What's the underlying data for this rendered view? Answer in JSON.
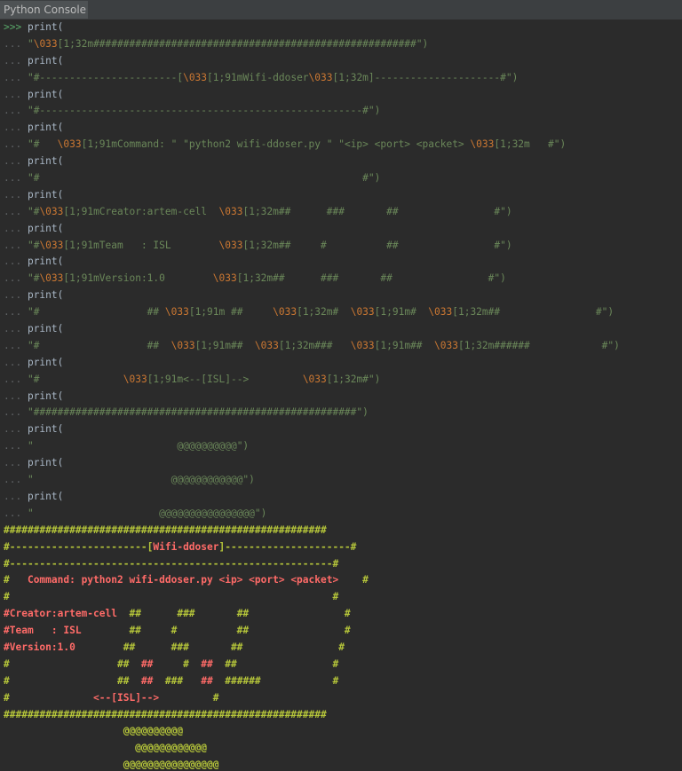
{
  "window": {
    "tab_label": "Python Console"
  },
  "console": {
    "prompt": ">>>",
    "continuation": "...",
    "print_call": "print(",
    "inputs": [
      [
        [
          "s",
          "\""
        ],
        [
          "esc",
          "\\033"
        ],
        [
          "s",
          "[1;32m######################################################\")"
        ]
      ],
      [
        [
          "s",
          "\"#-----------------------["
        ],
        [
          "esc",
          "\\033"
        ],
        [
          "s",
          "[1;91mWifi-ddoser"
        ],
        [
          "esc",
          "\\033"
        ],
        [
          "s",
          "[1;32m]---------------------#\")"
        ]
      ],
      [
        [
          "s",
          "\"#------------------------------------------------------#\")"
        ]
      ],
      [
        [
          "s",
          "\"#   "
        ],
        [
          "esc",
          "\\033"
        ],
        [
          "s",
          "[1;91mCommand: \" \"python2 wifi-ddoser.py \" \"<ip> <port> <packet> "
        ],
        [
          "esc",
          "\\033"
        ],
        [
          "s",
          "[1;32m   #\")"
        ]
      ],
      [
        [
          "s",
          "\"#                                                      #\")"
        ]
      ],
      [
        [
          "s",
          "\"#"
        ],
        [
          "esc",
          "\\033"
        ],
        [
          "s",
          "[1;91mCreator:artem-cell  "
        ],
        [
          "esc",
          "\\033"
        ],
        [
          "s",
          "[1;32m##      ###       ##                #\")"
        ]
      ],
      [
        [
          "s",
          "\"#"
        ],
        [
          "esc",
          "\\033"
        ],
        [
          "s",
          "[1;91mTeam   : ISL        "
        ],
        [
          "esc",
          "\\033"
        ],
        [
          "s",
          "[1;32m##     #          ##                #\")"
        ]
      ],
      [
        [
          "s",
          "\"#"
        ],
        [
          "esc",
          "\\033"
        ],
        [
          "s",
          "[1;91mVersion:1.0        "
        ],
        [
          "esc",
          "\\033"
        ],
        [
          "s",
          "[1;32m##      ###       ##                #\")"
        ]
      ],
      [
        [
          "s",
          "\"#                  ## "
        ],
        [
          "esc",
          "\\033"
        ],
        [
          "s",
          "[1;91m ##     "
        ],
        [
          "esc",
          "\\033"
        ],
        [
          "s",
          "[1;32m#  "
        ],
        [
          "esc",
          "\\033"
        ],
        [
          "s",
          "[1;91m#  "
        ],
        [
          "esc",
          "\\033"
        ],
        [
          "s",
          "[1;32m##                #\")"
        ]
      ],
      [
        [
          "s",
          "\"#                  ##  "
        ],
        [
          "esc",
          "\\033"
        ],
        [
          "s",
          "[1;91m##  "
        ],
        [
          "esc",
          "\\033"
        ],
        [
          "s",
          "[1;32m###   "
        ],
        [
          "esc",
          "\\033"
        ],
        [
          "s",
          "[1;91m##  "
        ],
        [
          "esc",
          "\\033"
        ],
        [
          "s",
          "[1;32m######            #\")"
        ]
      ],
      [
        [
          "s",
          "\"#              "
        ],
        [
          "esc",
          "\\033"
        ],
        [
          "s",
          "[1;91m<--[ISL]-->         "
        ],
        [
          "esc",
          "\\033"
        ],
        [
          "s",
          "[1;32m#\")"
        ]
      ],
      [
        [
          "s",
          "\"######################################################\")"
        ]
      ],
      [
        [
          "s",
          "\"                        @@@@@@@@@@\")"
        ]
      ],
      [
        [
          "s",
          "\"                       @@@@@@@@@@@@\")"
        ]
      ],
      [
        [
          "s",
          "\"                     @@@@@@@@@@@@@@@@\")"
        ]
      ]
    ],
    "output": [
      [
        [
          "g",
          "######################################################"
        ]
      ],
      [
        [
          "g",
          "#-----------------------["
        ],
        [
          "r",
          "Wifi-ddoser"
        ],
        [
          "g",
          "]---------------------#"
        ]
      ],
      [
        [
          "g",
          "#------------------------------------------------------#"
        ]
      ],
      [
        [
          "g",
          "#   "
        ],
        [
          "r",
          "Command: python2 wifi-ddoser.py <ip> <port> <packet>"
        ],
        [
          "g",
          "    #"
        ]
      ],
      [
        [
          "g",
          "#                                                      #"
        ]
      ],
      [
        [
          "r",
          "#Creator:artem-cell"
        ],
        [
          "g",
          "  ##      ###       ##                #"
        ]
      ],
      [
        [
          "r",
          "#Team   : ISL"
        ],
        [
          "g",
          "        ##     #          ##                #"
        ]
      ],
      [
        [
          "r",
          "#Version:1.0"
        ],
        [
          "g",
          "        ##      ###       ##                #"
        ]
      ],
      [
        [
          "g",
          "#                  ##  "
        ],
        [
          "r",
          "##"
        ],
        [
          "g",
          "     #  "
        ],
        [
          "r",
          "##"
        ],
        [
          "g",
          "  ##                #"
        ]
      ],
      [
        [
          "g",
          "#                  ##  "
        ],
        [
          "r",
          "##"
        ],
        [
          "g",
          "  ###   "
        ],
        [
          "r",
          "##"
        ],
        [
          "g",
          "  ######            #"
        ]
      ],
      [
        [
          "g",
          "#              "
        ],
        [
          "r",
          "<--[ISL]-->"
        ],
        [
          "g",
          "         #"
        ]
      ],
      [
        [
          "g",
          "######################################################"
        ]
      ],
      [
        [
          "g",
          "                    @@@@@@@@@@"
        ]
      ],
      [
        [
          "g",
          "                      @@@@@@@@@@@@"
        ]
      ],
      [
        [
          "g",
          "                    @@@@@@@@@@@@@@@@"
        ]
      ]
    ]
  },
  "colors": {
    "background": "#2b2b2b",
    "prompt": "#59a869",
    "string": "#6a8759",
    "escape": "#cc7832",
    "output_green": "#b5c53a",
    "output_red": "#ff6b68"
  }
}
